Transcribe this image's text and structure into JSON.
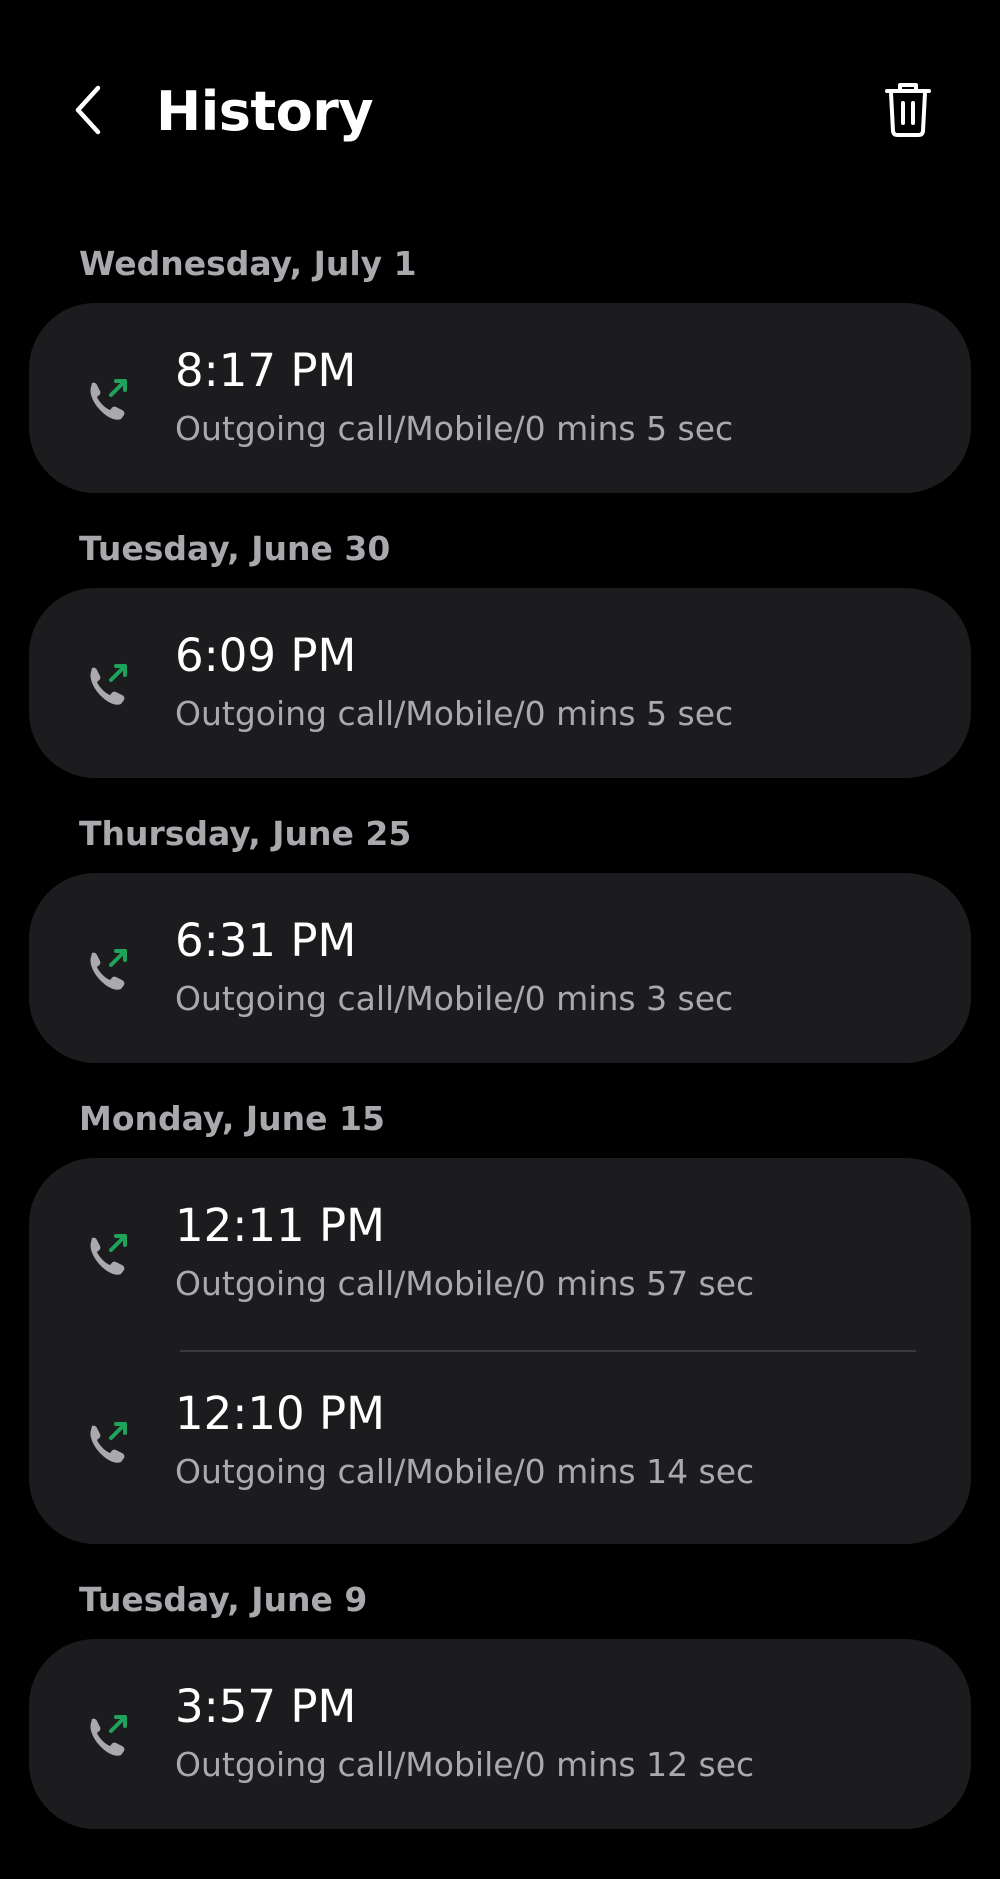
{
  "header": {
    "title": "History",
    "back_icon": "chevron-left-icon",
    "delete_icon": "trash-icon"
  },
  "colors": {
    "background": "#000000",
    "card": "#1c1c1f",
    "primary_text": "#ffffff",
    "secondary_text": "#a9a9ae",
    "call_arrow": "#1fa35a",
    "phone_icon": "#a9a9ae"
  },
  "groups": [
    {
      "date": "Wednesday, July 1",
      "calls": [
        {
          "time": "8:17 PM",
          "detail": "Outgoing call/Mobile/0 mins 5 sec"
        }
      ]
    },
    {
      "date": "Tuesday, June 30",
      "calls": [
        {
          "time": "6:09 PM",
          "detail": "Outgoing call/Mobile/0 mins 5 sec"
        }
      ]
    },
    {
      "date": "Thursday, June 25",
      "calls": [
        {
          "time": "6:31 PM",
          "detail": "Outgoing call/Mobile/0 mins 3 sec"
        }
      ]
    },
    {
      "date": "Monday, June 15",
      "calls": [
        {
          "time": "12:11 PM",
          "detail": "Outgoing call/Mobile/0 mins 57 sec"
        },
        {
          "time": "12:10 PM",
          "detail": "Outgoing call/Mobile/0 mins 14 sec"
        }
      ]
    },
    {
      "date": "Tuesday, June 9",
      "calls": [
        {
          "time": "3:57 PM",
          "detail": "Outgoing call/Mobile/0 mins 12 sec"
        }
      ]
    }
  ]
}
